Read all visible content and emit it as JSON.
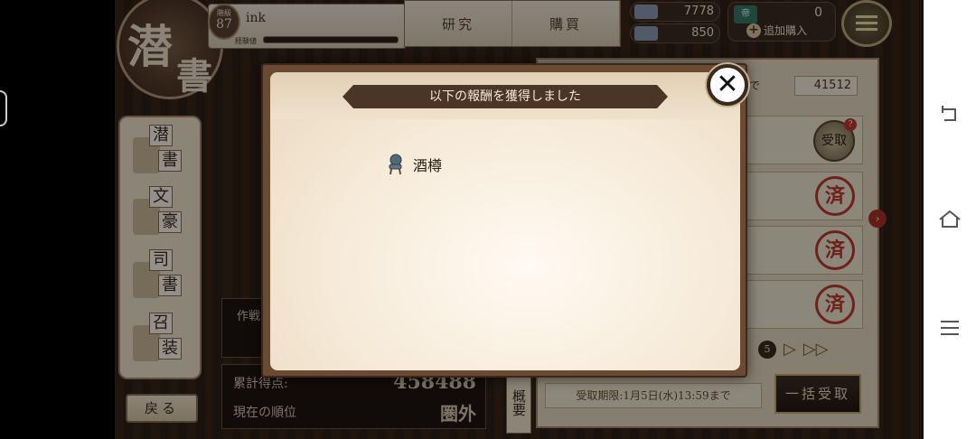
{
  "player": {
    "level_label": "階級",
    "level": "87",
    "name": "ink",
    "exp_label": "経験値",
    "exp_fraction": 0.0
  },
  "top_menu": {
    "tabs": [
      {
        "label": "研究"
      },
      {
        "label": "購買"
      }
    ]
  },
  "currency": {
    "item1": "7778",
    "item2": "850",
    "premium_icon_label": "帝",
    "premium": "0",
    "buy_label": "追加購入"
  },
  "side_menu": {
    "items": [
      {
        "a": "潜",
        "b": "書"
      },
      {
        "a": "文",
        "b": "豪"
      },
      {
        "a": "司",
        "b": "書"
      },
      {
        "a": "召",
        "b": "装"
      }
    ],
    "back_label": "戻る"
  },
  "logo": {
    "ch1": "潜",
    "ch2": "書"
  },
  "score": {
    "strategy_label": "作戦",
    "total_label": "累計得点:",
    "total_value": "458488",
    "rank_label": "現在の順位",
    "rank_value": "圏外"
  },
  "summary_label": "概要",
  "reward_panel": {
    "count_label": "まで",
    "count_value": "41512",
    "receive_label": "受取",
    "receive_badge": "?",
    "stamp_label": "済",
    "page_number": "5",
    "deadline": "受取期限:1月5日(水)13:59まで",
    "bulk_label": "一括受取"
  },
  "dialog": {
    "title": "以下の報酬を獲得しました",
    "reward_name": "酒樽",
    "reward_icon": "chair-icon",
    "close_symbol": "✕"
  },
  "colors": {
    "dialog_frame": "#6a4a32",
    "ribbon": "#4a3526",
    "stamp_red": "#c0392b"
  }
}
